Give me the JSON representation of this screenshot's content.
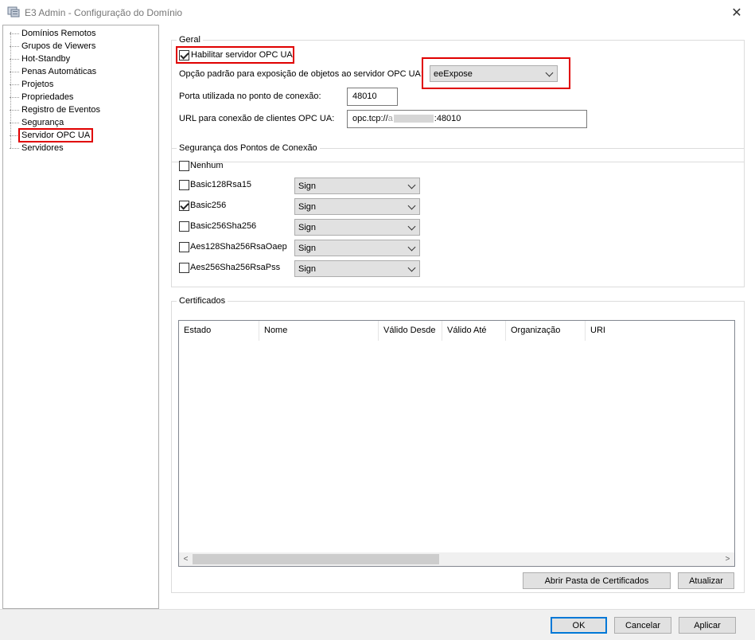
{
  "window": {
    "title": "E3 Admin - Configuração do Domínio",
    "close_glyph": "✕"
  },
  "tree": {
    "items": [
      {
        "label": "Domínios Remotos"
      },
      {
        "label": "Grupos de Viewers"
      },
      {
        "label": "Hot-Standby"
      },
      {
        "label": "Penas Automáticas"
      },
      {
        "label": "Projetos"
      },
      {
        "label": "Propriedades"
      },
      {
        "label": "Registro de Eventos"
      },
      {
        "label": "Segurança"
      },
      {
        "label": "Servidor OPC UA",
        "selected": true
      },
      {
        "label": "Servidores"
      }
    ]
  },
  "geral": {
    "legend": "Geral",
    "enable_label": "Habilitar servidor OPC UA",
    "enable_checked": true,
    "exposure_label": "Opção padrão para exposição de objetos ao servidor OPC UA:",
    "exposure_value": "eeExpose",
    "port_label": "Porta utilizada no ponto de conexão:",
    "port_value": "48010",
    "url_label": "URL para conexão de clientes OPC UA:",
    "url_prefix": "opc.tcp://",
    "url_host_partial": "a",
    "url_suffix": ":48010"
  },
  "seguranca": {
    "legend": "Segurança dos Pontos de Conexão",
    "none_label": "Nenhum",
    "none_checked": false,
    "policies": [
      {
        "label": "Basic128Rsa15",
        "checked": false,
        "mode": "Sign"
      },
      {
        "label": "Basic256",
        "checked": true,
        "mode": "Sign"
      },
      {
        "label": "Basic256Sha256",
        "checked": false,
        "mode": "Sign"
      },
      {
        "label": "Aes128Sha256RsaOaep",
        "checked": false,
        "mode": "Sign"
      },
      {
        "label": "Aes256Sha256RsaPss",
        "checked": false,
        "mode": "Sign"
      }
    ]
  },
  "certificados": {
    "legend": "Certificados",
    "columns": [
      "Estado",
      "Nome",
      "Válido Desde",
      "Válido Até",
      "Organização",
      "URI"
    ],
    "scroll_left": "<",
    "scroll_right": ">",
    "open_folder_button": "Abrir Pasta de Certificados",
    "refresh_button": "Atualizar"
  },
  "footer": {
    "ok": "OK",
    "cancel": "Cancelar",
    "apply": "Aplicar"
  },
  "colors": {
    "highlight": "#e00000",
    "accent": "#0078d7"
  }
}
